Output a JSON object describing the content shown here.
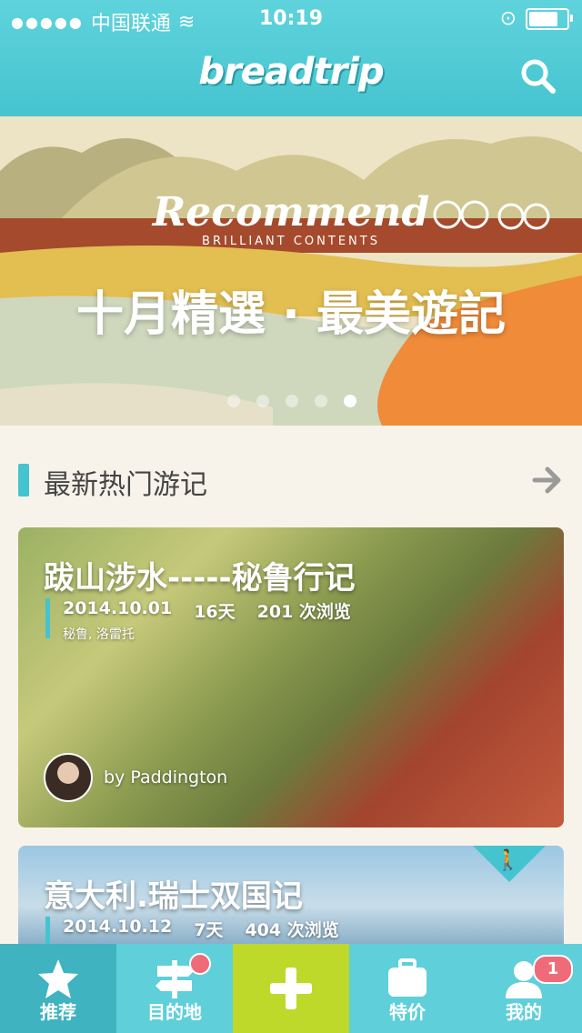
{
  "status": {
    "carrier": "中国联通",
    "time": "10:19"
  },
  "header": {
    "logo": "breadtrip"
  },
  "banner": {
    "script": "Recommend",
    "subtitle": "BRILLIANT CONTENTS",
    "title": "十月精選 · 最美遊記",
    "page_count": 5,
    "active_page": 5
  },
  "section": {
    "title": "最新热门游记"
  },
  "cards": [
    {
      "title": "跋山涉水-----秘鲁行记",
      "date": "2014.10.01",
      "days": "16天",
      "views": "201 次浏览",
      "location": "秘鲁, 洛雷托",
      "author": "by Paddington"
    },
    {
      "title": "意大利.瑞士双国记",
      "date": "2014.10.12",
      "days": "7天",
      "views": "404 次浏览"
    }
  ],
  "tabs": [
    {
      "label": "推荐"
    },
    {
      "label": "目的地"
    },
    {
      "label": ""
    },
    {
      "label": "特价"
    },
    {
      "label": "我的",
      "badge": "1"
    }
  ],
  "colors": {
    "accent": "#45c4cf",
    "plus": "#bfd92b",
    "badge": "#f06b7a"
  }
}
